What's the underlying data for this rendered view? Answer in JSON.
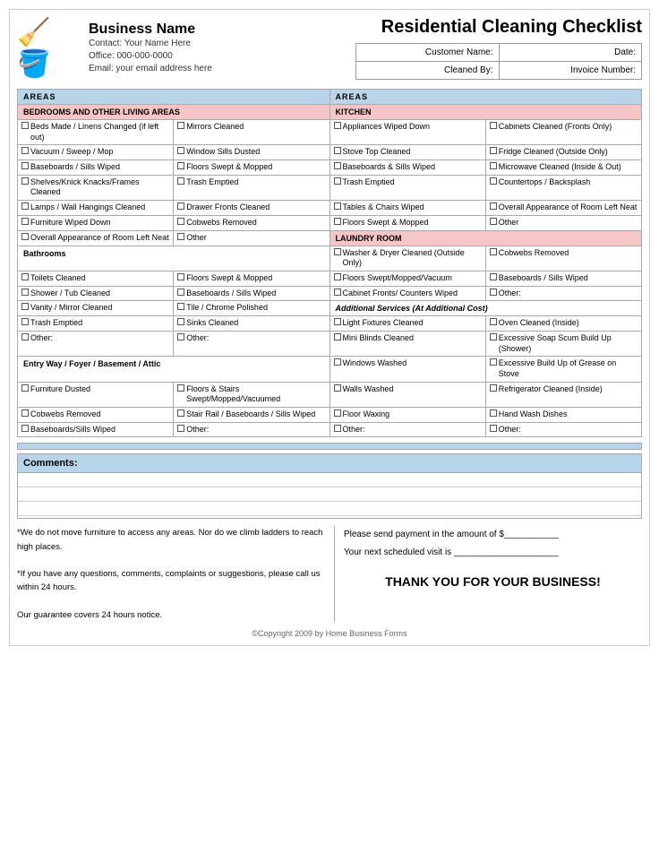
{
  "title": "Residential Cleaning Checklist",
  "business": {
    "name": "Business Name",
    "contact": "Contact:  Your Name Here",
    "office": "Office:  000-000-0000",
    "email": "Email:  your email address here"
  },
  "customer_fields": {
    "name_label": "Customer Name:",
    "date_label": "Date:",
    "cleaned_by_label": "Cleaned By:",
    "invoice_label": "Invoice Number:"
  },
  "areas_header_left": "AREAS",
  "areas_header_right": "AREAS",
  "left": {
    "section1": {
      "header": "BEDROOMS AND OTHER LIVING AREAS",
      "items_col1": [
        "Beds Made / Linens Changed (if left out)",
        "Vacuum / Sweep / Mop",
        "Baseboards / Sills Wiped",
        "Shelves/Knick Knacks/Frames Cleaned",
        "Lamps / Wall Hangings Cleaned",
        "Furniture Wiped Down",
        "Overall Appearance of Room Left Neat"
      ],
      "items_col2": [
        "Mirrors Cleaned",
        "Window Sills Dusted",
        "Floors Swept & Mopped",
        "Trash Emptied",
        "Drawer Fronts Cleaned",
        "Cobwebs Removed",
        "Other"
      ]
    },
    "section2": {
      "header": "Bathrooms",
      "items_col1": [
        "Toilets Cleaned",
        "Shower / Tub Cleaned",
        "Vanity / Mirror Cleaned",
        "Trash Emptied",
        "Other:"
      ],
      "items_col2": [
        "Floors Swept & Mopped",
        "Baseboards / Sills Wiped",
        "Tile / Chrome Polished",
        "Sinks Cleaned",
        "Other:"
      ]
    },
    "section3": {
      "header": "Entry Way / Foyer / Basement / Attic",
      "items_col1": [
        "Furniture Dusted",
        "Cobwebs Removed",
        "Baseboards/Sills Wiped"
      ],
      "items_col2": [
        "Floors & Stairs Swept/Mopped/Vacuumed",
        "Stair Rail / Baseboards / Sills Wiped",
        "Other:"
      ]
    }
  },
  "right": {
    "section1": {
      "header": "KITCHEN",
      "items_col1": [
        "Appliances Wiped Down",
        "Stove Top Cleaned",
        "Baseboards & Sills Wiped",
        "Trash Emptied",
        "Tables & Chairs Wiped",
        "Floors Swept & Mopped"
      ],
      "items_col2": [
        "Cabinets Cleaned (Fronts Only)",
        "Fridge Cleaned (Outside Only)",
        "Microwave Cleaned (Inside & Out)",
        "Countertops / Backsplash",
        "Overall Appearance of Room Left Neat",
        "Other"
      ]
    },
    "section2": {
      "header": "LAUNDRY ROOM",
      "items_col1": [
        "Washer & Dryer Cleaned (Outside Only)",
        "Floors Swept/Mopped/Vacuum",
        "Cabinet Fronts/ Counters Wiped"
      ],
      "items_col2": [
        "Cobwebs Removed",
        "Baseboards / Sills Wiped",
        "Other:"
      ]
    },
    "section3": {
      "header": "Additional Services (At Additional Cost)",
      "items_col1": [
        "Light Fixtures Cleaned",
        "Mini Blinds Cleaned",
        "Windows Washed",
        "Walls Washed",
        "Floor Waxing",
        "Other:"
      ],
      "items_col2": [
        "Oven Cleaned (Inside)",
        "Excessive Soap Scum Build Up (Shower)",
        "Excessive Build Up of Grease on Stove",
        "Refrigerator Cleaned (Inside)",
        "Hand Wash Dishes",
        "Other:"
      ]
    }
  },
  "comments": {
    "label": "Comments:"
  },
  "footer": {
    "note1": "*We do not move furniture to access any areas.  Nor do we climb ladders to reach high places.",
    "note2": "*If you have any questions, comments, complaints or suggestions, please call us within 24 hours.",
    "note3": "Our guarantee covers 24 hours notice.",
    "payment": "Please send payment in the amount of $___________",
    "next_visit": "Your next scheduled visit is  _____________________",
    "thank_you": "THANK YOU FOR YOUR BUSINESS!"
  },
  "copyright": "©Copyright 2009 by Home Business Forms"
}
